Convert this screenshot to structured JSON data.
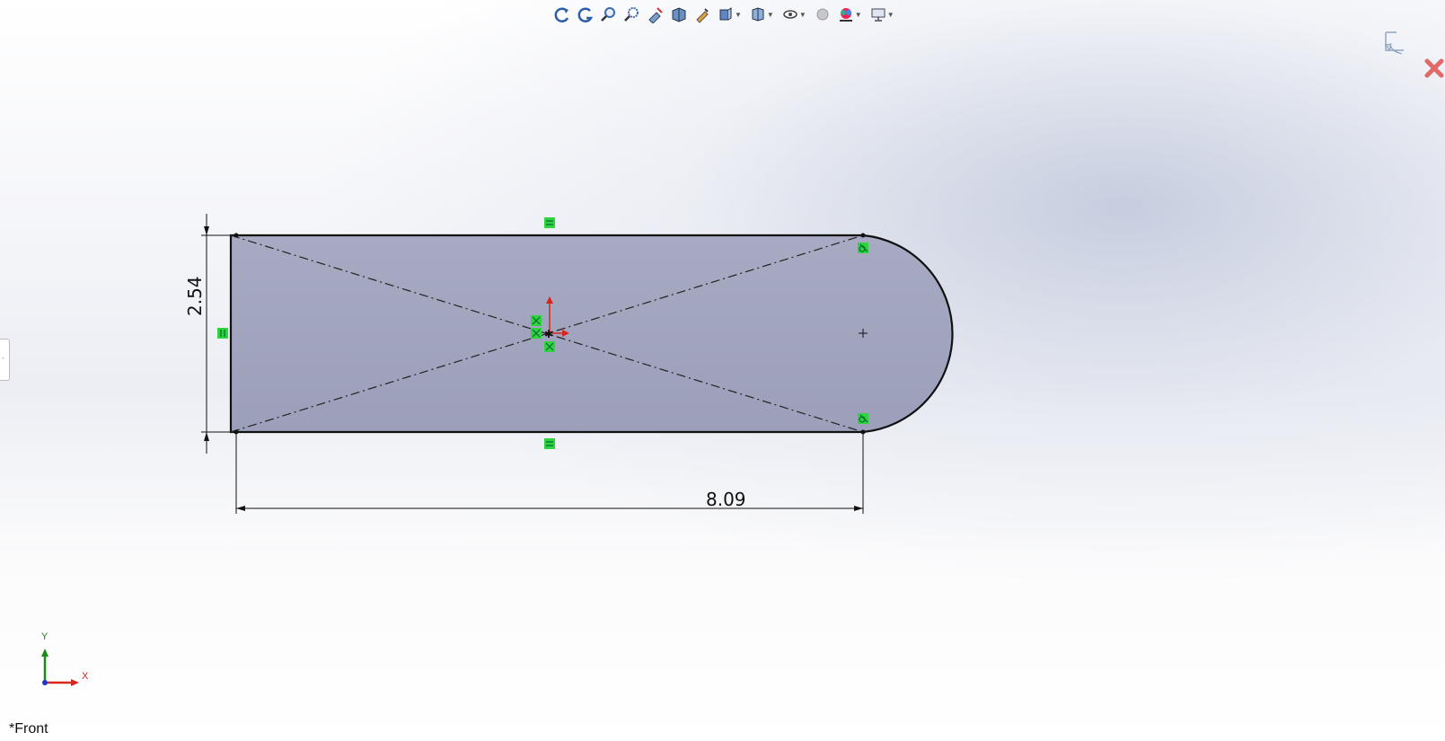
{
  "toolbar": {
    "items": [
      {
        "name": "previous-view-icon"
      },
      {
        "name": "redo-view-icon"
      },
      {
        "name": "zoom-to-fit-icon"
      },
      {
        "name": "zoom-to-area-icon"
      },
      {
        "name": "previous-view-2-icon"
      },
      {
        "name": "section-view-icon"
      },
      {
        "name": "dynamic-annotation-icon"
      },
      {
        "name": "view-orientation-icon"
      },
      {
        "name": "display-style-icon"
      },
      {
        "name": "hide-show-items-icon"
      },
      {
        "name": "edit-appearance-icon"
      },
      {
        "name": "apply-scene-icon"
      },
      {
        "name": "view-settings-icon"
      }
    ]
  },
  "dimensions": {
    "horizontal": "8.09",
    "vertical": "2.54"
  },
  "view": {
    "name": "*Front"
  },
  "triad": {
    "x_label": "X",
    "y_label": "Y"
  },
  "colors": {
    "sketch_fill": "#a3a6bf",
    "relation_green": "#2fd23f",
    "axis_red": "#d8261f",
    "axis_green": "#1a8a1a",
    "axis_blue": "#2233cc"
  }
}
